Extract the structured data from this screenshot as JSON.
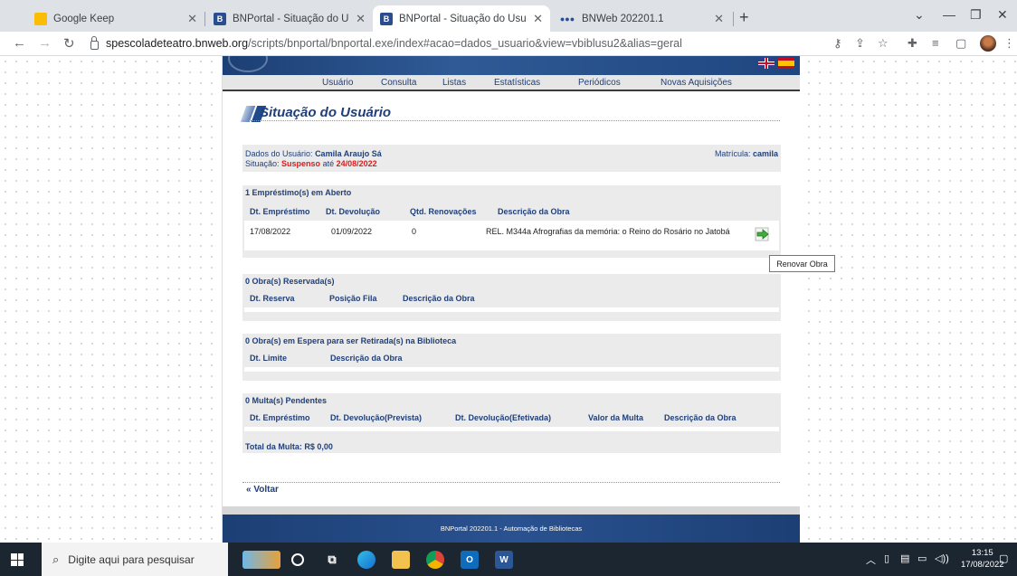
{
  "browser": {
    "tabs": [
      {
        "title": "Google Keep",
        "active": false
      },
      {
        "title": "BNPortal - Situação do Usuário",
        "active": false
      },
      {
        "title": "BNPortal - Situação do Usuário",
        "active": true
      },
      {
        "title": "BNWeb 202201.1",
        "active": false
      }
    ],
    "url_host": "spescoladeteatro.bnweb.org",
    "url_path": "/scripts/bnportal/bnportal.exe/index#acao=dados_usuario&view=vbiblusu2&alias=geral"
  },
  "menu": [
    "Usuário",
    "Consulta",
    "Listas",
    "Estatísticas",
    "Periódicos",
    "Novas Aquisições"
  ],
  "page_title": "Situação do Usuário",
  "user": {
    "label_dados": "Dados do Usuário:",
    "name": "Camila Araujo Sá",
    "label_situacao": "Situação:",
    "status": "Suspenso",
    "ate": "até",
    "until": "24/08/2022",
    "label_matricula": "Matrícula:",
    "matricula": "camila"
  },
  "loans": {
    "header": "1 Empréstimo(s) em Aberto",
    "columns": [
      "Dt. Empréstimo",
      "Dt. Devolução",
      "Qtd. Renovações",
      "Descrição da Obra"
    ],
    "rows": [
      {
        "emprestimo": "17/08/2022",
        "devolucao": "01/09/2022",
        "renovacoes": "0",
        "descricao": "REL. M344a Afrografias da memória: o Reino do Rosário no Jatobá"
      }
    ],
    "renew_tooltip": "Renovar Obra"
  },
  "reservations": {
    "header": "0 Obra(s) Reservada(s)",
    "columns": [
      "Dt. Reserva",
      "Posição Fila",
      "Descrição da Obra"
    ]
  },
  "waiting": {
    "header": "0 Obra(s) em Espera para ser Retirada(s) na Biblioteca",
    "columns": [
      "Dt. Limite",
      "Descrição da Obra"
    ]
  },
  "fines": {
    "header": "0 Multa(s) Pendentes",
    "columns": [
      "Dt. Empréstimo",
      "Dt. Devolução(Prevista)",
      "Dt. Devolução(Efetivada)",
      "Valor da Multa",
      "Descrição da Obra"
    ],
    "total_label": "Total da Multa: R$ 0,00"
  },
  "back_label": "Voltar",
  "footer": "BNPortal 202201.1 - Automação de Bibliotecas",
  "taskbar": {
    "search_placeholder": "Digite aqui para pesquisar",
    "time": "13:15",
    "date": "17/08/2022"
  },
  "colors": {
    "accent": "#1f3f7a",
    "banner": "#1c3f74",
    "alert": "#e01b1b"
  }
}
